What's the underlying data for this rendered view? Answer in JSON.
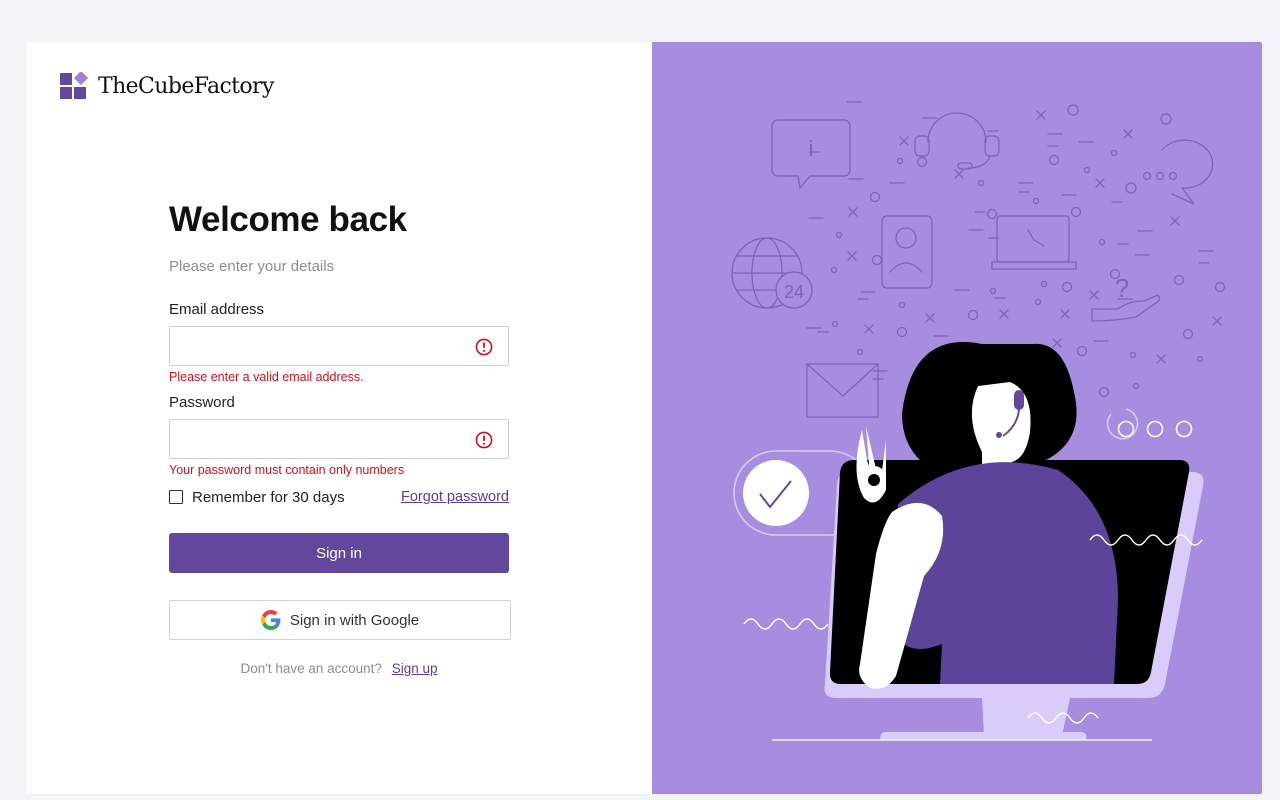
{
  "brand": {
    "logo_text": "TheCubeFactory",
    "icon": "cube-logo-icon",
    "accent": "#62489d",
    "panel_color": "#a68ddf"
  },
  "login": {
    "title": "Welcome back",
    "subtitle": "Please enter your details",
    "email": {
      "label": "Email address",
      "value": "",
      "error": "Please enter a valid email address.",
      "icon": "alert-circle-icon"
    },
    "password": {
      "label": "Password",
      "value": "",
      "error": "Your password must contain only numbers",
      "icon": "alert-circle-icon"
    },
    "remember": {
      "label": "Remember for 30 days",
      "checked": false
    },
    "forgot_link": "Forgot password",
    "signin_button": "Sign in",
    "google_button": "Sign in with Google",
    "no_account_text": "Don't have an account?",
    "signup_link": "Sign up"
  },
  "illustration": {
    "clock_badge": "24",
    "help_mark": "?",
    "info_mark": "i"
  },
  "colors": {
    "error": "#c8141e",
    "link": "#5b3c9a"
  }
}
